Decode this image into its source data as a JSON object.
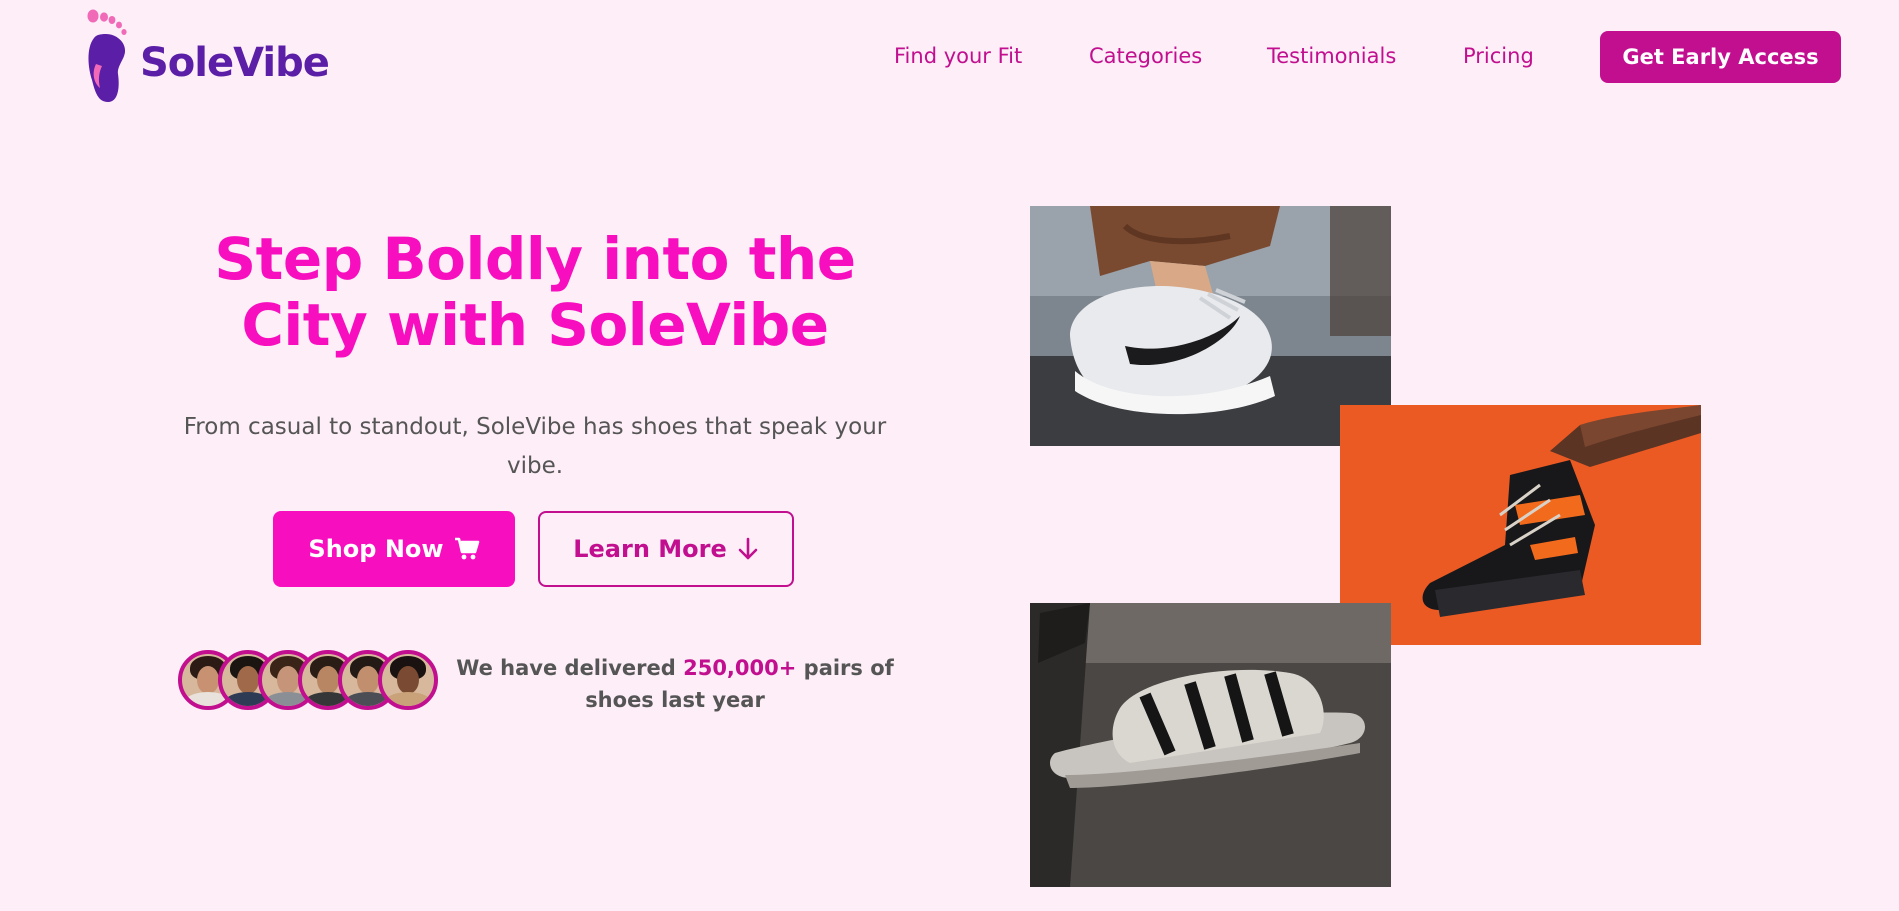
{
  "brand": {
    "name": "SoleVibe",
    "logo_icon": "footprint-icon",
    "colors": {
      "purple": "#5b1ea6",
      "pink": "#f70fbf",
      "magenta": "#c10f8f",
      "background": "#fdeef7"
    }
  },
  "nav": {
    "links": [
      "Find your Fit",
      "Categories",
      "Testimonials",
      "Pricing"
    ],
    "cta": "Get Early Access"
  },
  "hero": {
    "title_line1": "Step Boldly into the",
    "title_line2": "City with SoleVibe",
    "subtitle": "From casual to standout, SoleVibe has shoes that speak your vibe.",
    "primary_button": "Shop Now",
    "primary_icon": "cart-icon",
    "secondary_button": "Learn More",
    "secondary_icon": "arrow-down-icon"
  },
  "social_proof": {
    "avatar_count": 6,
    "stat_prefix": "We have delivered",
    "stat_number": "250,000+",
    "stat_suffix": "pairs of shoes last year"
  },
  "gallery": {
    "images": [
      "sneaker-photo",
      "boot-photo",
      "sandal-photo"
    ]
  }
}
